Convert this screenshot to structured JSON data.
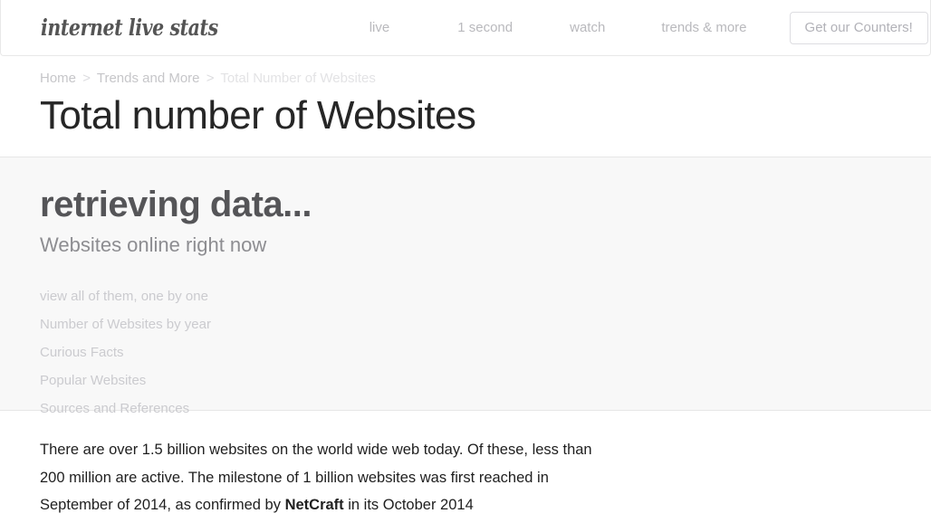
{
  "header": {
    "logo": "internet live stats",
    "nav": [
      {
        "label": "live"
      },
      {
        "label": "1 second"
      },
      {
        "label": "watch"
      },
      {
        "label": "trends & more"
      }
    ],
    "cta_label": "Get our Counters!"
  },
  "breadcrumb": {
    "home": "Home",
    "separator": ">",
    "parent": "Trends and More",
    "current": "Total Number of Websites"
  },
  "page": {
    "title": "Total number of Websites"
  },
  "counter": {
    "value": "retrieving data...",
    "caption": "Websites online right now",
    "links": [
      {
        "label": "view all of them, one by one"
      },
      {
        "label": "Number of Websites by year"
      },
      {
        "label": "Curious Facts"
      },
      {
        "label": "Popular Websites"
      },
      {
        "label": "Sources and References"
      }
    ]
  },
  "article": {
    "part1": "There are over 1.5 billion websites on the world wide web today. Of these, less than 200 million are active. The milestone of 1 billion websites was first reached in September of 2014, as confirmed by ",
    "bold": "NetCraft",
    "part2": " in its October 2014"
  },
  "colors": {
    "section_background": "#f8f8f8",
    "divider": "#e6e6e6",
    "title": "#262626",
    "muted_link": "#cbcbcf"
  }
}
